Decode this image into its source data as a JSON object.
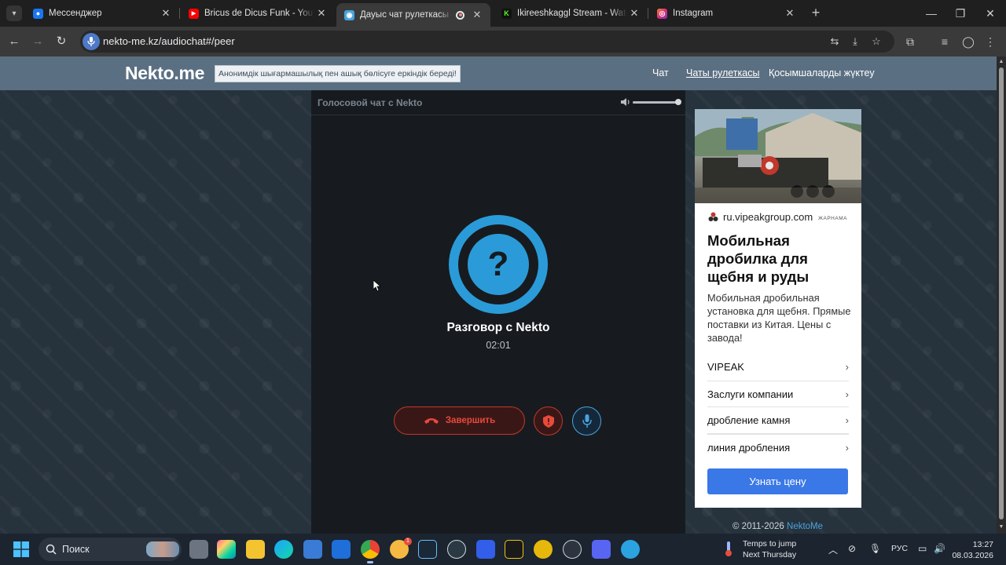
{
  "browser": {
    "tabs": [
      {
        "title": "Мессенджер",
        "favicon": "messenger-icon",
        "color": "#1877f2"
      },
      {
        "title": "Bricus de Dicus Funk - YouTube",
        "favicon": "youtube-icon",
        "color": "#ff0000"
      },
      {
        "title": "Дауыс чат рулеткасы — Ne",
        "favicon": "nekto-icon",
        "color": "#4aa3df",
        "active": true
      },
      {
        "title": "Ikireeshkaggl Stream - Watch Li",
        "favicon": "kick-icon",
        "color": "#53fc18"
      },
      {
        "title": "Instagram",
        "favicon": "instagram-icon",
        "color": "#e1306c"
      }
    ],
    "url": "nekto-me.kz/audiochat#/peer"
  },
  "site": {
    "logo": "Nekto.me",
    "slogan": "Анонимдік шығармашылық пен ашық бөлісуге еркіндік береді!",
    "nav": [
      "Чат",
      "Чаты рулеткасы",
      "Қосымшаларды жүктеу"
    ],
    "nav_current": 1
  },
  "chat": {
    "header": "Голосовой чат с Nekto",
    "volume": 1.0,
    "avatar_glyph": "?",
    "peer_name": "Разговор с Nekto",
    "timer": "02:01",
    "end_label": "Завершить"
  },
  "ad": {
    "domain": "ru.vipeakgroup.com",
    "label": "ЖАРНАМА",
    "title": "Мобильная дробилка для щебня и руды",
    "text": "Мобильная дробильная установка для щебня. Прямые поставки из Китая. Цены с завода!",
    "links": [
      "VIPEAK",
      "Заслуги компании",
      "дробление камня",
      "линия дробления"
    ],
    "cta": "Узнать цену"
  },
  "footer": {
    "copyright": "© 2011-2026",
    "brand": "NektoMe"
  },
  "taskbar": {
    "search": "Поиск",
    "weather_line1": "Temps to jump",
    "weather_line2": "Next Thursday",
    "lang": "РУС",
    "time": "13:27",
    "date": "08.03.2026",
    "badge": "1"
  }
}
